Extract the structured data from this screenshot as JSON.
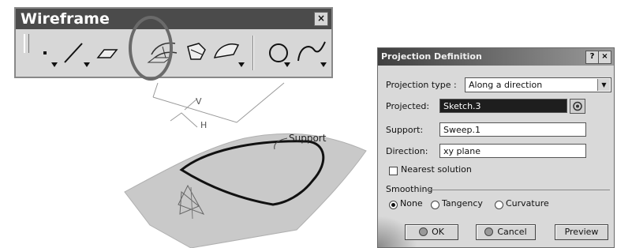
{
  "toolbar": {
    "title": "Wireframe",
    "close_label": "×",
    "icons": [
      "point-icon",
      "line-icon",
      "plane-icon",
      "projection-icon",
      "intersection-icon",
      "parallel-curve-icon",
      "circle-icon",
      "spline-icon"
    ]
  },
  "scene": {
    "support_label": "Support",
    "v_label": "V",
    "h_label": "H"
  },
  "dialog": {
    "title": "Projection Definition",
    "help_label": "?",
    "close_label": "×",
    "projection_type_label": "Projection type :",
    "projection_type_value": "Along a direction",
    "projected_label": "Projected:",
    "projected_value": "Sketch.3",
    "support_label": "Support:",
    "support_value": "Sweep.1",
    "direction_label": "Direction:",
    "direction_value": "xy plane",
    "nearest_solution_label": "Nearest solution",
    "smoothing_label": "Smoothing",
    "smoothing_options": [
      {
        "label": "None",
        "selected": true
      },
      {
        "label": "Tangency",
        "selected": false
      },
      {
        "label": "Curvature",
        "selected": false
      }
    ],
    "ok_label": "OK",
    "cancel_label": "Cancel",
    "preview_label": "Preview"
  },
  "colors": {
    "toolbar_title_bg": "#4b4b4b",
    "highlight_circle": "#6a6a6a",
    "selected_field_bg": "#1e1e1e",
    "surface": "#c8c8c8"
  }
}
